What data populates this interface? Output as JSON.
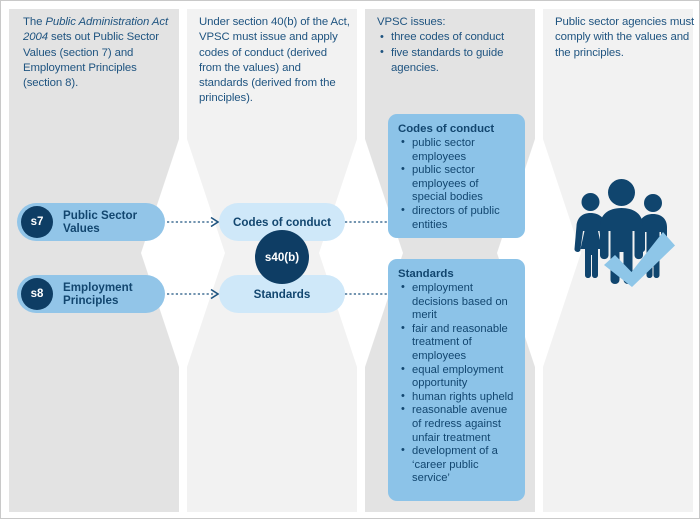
{
  "diagram": {
    "title": "Public Administration Act 2004 values and principles flow",
    "colors": {
      "col_bg_dark": "#e3e3e3",
      "col_bg_light": "#f2f2f2",
      "text_blue": "#1f5480",
      "pill_blue": "#92c5e8",
      "pill_light_blue": "#cfe8f9",
      "badge_navy": "#0e3d64",
      "infobox_blue": "#8cc3e8",
      "icon_navy": "#10456e",
      "tick_light_blue": "#8ec6e8"
    },
    "columns": [
      {
        "id": "col1",
        "heading_html": "The <em>Public Administration Act 2004</em> sets out Public Sector Values (section 7) and Employment Principles (section 8).",
        "heading_plain": "The Public Administration Act 2004 sets out Public Sector Values (section 7) and Employment Principles (section 8)."
      },
      {
        "id": "col2",
        "heading_plain": "Under section 40(b) of the Act, VPSC must issue and apply codes of conduct (derived from the values) and standards (derived from the principles)."
      },
      {
        "id": "col3",
        "heading_plain": "VPSC issues:",
        "bullets": [
          "three codes of conduct",
          "five standards to guide agencies."
        ]
      },
      {
        "id": "col4",
        "heading_plain": "Public sector agencies must comply with the values and the principles."
      }
    ],
    "pills": [
      {
        "badge": "s7",
        "label": "Public Sector Values"
      },
      {
        "badge": "s8",
        "label": "Employment Principles"
      }
    ],
    "middle": {
      "top_pill": "Codes of conduct",
      "bottom_pill": "Standards",
      "circle": "s40(b)"
    },
    "boxes": [
      {
        "title": "Codes of conduct",
        "items": [
          "public sector employees",
          "public sector employees of special bodies",
          "directors of public entities"
        ]
      },
      {
        "title": "Standards",
        "items": [
          "employment decisions based on merit",
          "fair and reasonable treatment of employees",
          "equal employment opportunity",
          "human rights upheld",
          "reasonable avenue of redress against unfair treatment",
          "development of a ‘career public service’"
        ]
      }
    ],
    "icons": {
      "people_group": "people-group-icon",
      "check": "check-mark-icon",
      "arrow": "dotted-arrow-icon",
      "chevron": "chevron-band-icon"
    }
  }
}
